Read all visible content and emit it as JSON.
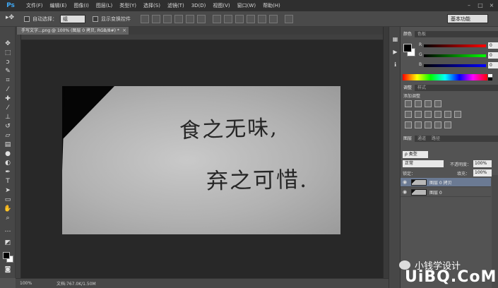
{
  "app": {
    "logo": "Ps"
  },
  "menu": [
    "文件(F)",
    "编辑(E)",
    "图像(I)",
    "图层(L)",
    "类型(Y)",
    "选择(S)",
    "滤镜(T)",
    "3D(D)",
    "视图(V)",
    "窗口(W)",
    "帮助(H)"
  ],
  "options": {
    "tool_icon": "move-tool-icon",
    "auto_select_label": "自动选择：",
    "auto_select_value": "组",
    "transform_label": "显示变换控件",
    "workspace": "基本功能"
  },
  "document": {
    "tab_title": "手写文字...png @ 100% (图层 0 拷贝, RGB/8#) *",
    "text_line1": "食之无味,",
    "text_line2": "弃之可惜."
  },
  "status": {
    "zoom": "100%",
    "doc_size": "文档:767.0K/1.50M"
  },
  "color_panel": {
    "tabs": [
      "颜色",
      "色板"
    ],
    "channels": [
      {
        "label": "R",
        "value": "0",
        "color": "#ff0000"
      },
      {
        "label": "G",
        "value": "0",
        "color": "#00ff00"
      },
      {
        "label": "B",
        "value": "0",
        "color": "#0000ff"
      }
    ]
  },
  "adjust_panel": {
    "tabs": [
      "调整",
      "样式"
    ],
    "title": "添加调整"
  },
  "layers_panel": {
    "tabs": [
      "图层",
      "通道",
      "路径"
    ],
    "kind": "ρ 类型",
    "blend": "正常",
    "opacity_label": "不透明度：",
    "opacity": "100%",
    "lock_label": "锁定：",
    "fill_label": "填充：",
    "fill": "100%",
    "layers": [
      {
        "name": "图层 0 拷贝",
        "selected": true
      },
      {
        "name": "图层 0",
        "selected": false
      }
    ]
  },
  "watermark": {
    "text": "小钱学设计",
    "brand": "UiBQ.CoM"
  }
}
